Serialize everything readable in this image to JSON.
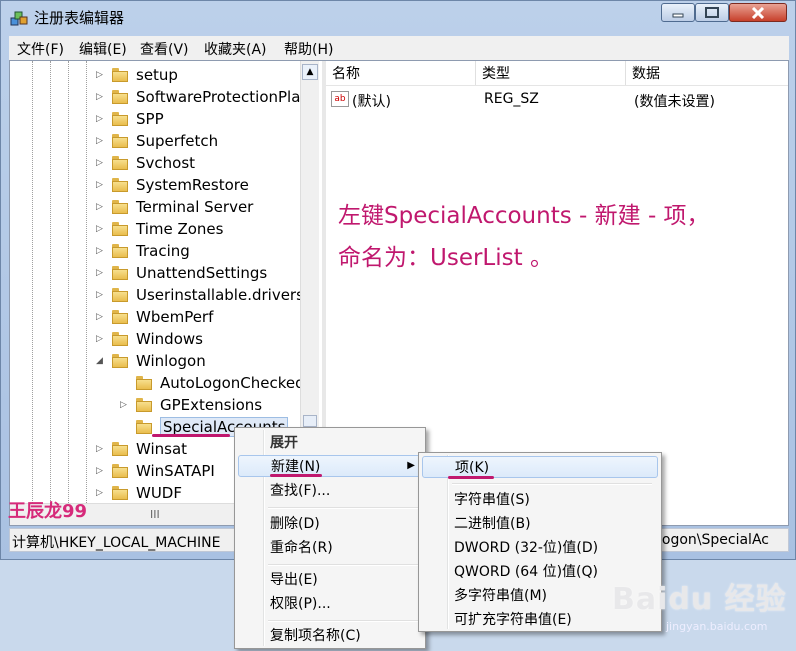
{
  "window": {
    "title": "注册表编辑器"
  },
  "menubar": [
    "文件(F)",
    "编辑(E)",
    "查看(V)",
    "收藏夹(A)",
    "帮助(H)"
  ],
  "tree": {
    "nodes": [
      {
        "label": "setup",
        "level": 0,
        "expander": "collapsed"
      },
      {
        "label": "SoftwareProtectionPla",
        "level": 0,
        "expander": "collapsed"
      },
      {
        "label": "SPP",
        "level": 0,
        "expander": "collapsed"
      },
      {
        "label": "Superfetch",
        "level": 0,
        "expander": "collapsed"
      },
      {
        "label": "Svchost",
        "level": 0,
        "expander": "collapsed"
      },
      {
        "label": "SystemRestore",
        "level": 0,
        "expander": "collapsed"
      },
      {
        "label": "Terminal Server",
        "level": 0,
        "expander": "collapsed"
      },
      {
        "label": "Time Zones",
        "level": 0,
        "expander": "collapsed"
      },
      {
        "label": "Tracing",
        "level": 0,
        "expander": "collapsed"
      },
      {
        "label": "UnattendSettings",
        "level": 0,
        "expander": "collapsed"
      },
      {
        "label": "Userinstallable.drivers",
        "level": 0,
        "expander": "collapsed"
      },
      {
        "label": "WbemPerf",
        "level": 0,
        "expander": "collapsed"
      },
      {
        "label": "Windows",
        "level": 0,
        "expander": "collapsed"
      },
      {
        "label": "Winlogon",
        "level": 0,
        "expander": "expanded"
      },
      {
        "label": "AutoLogonChecked",
        "level": 1,
        "expander": "none"
      },
      {
        "label": "GPExtensions",
        "level": 1,
        "expander": "collapsed"
      },
      {
        "label": "SpecialAccounts",
        "level": 1,
        "expander": "none",
        "selected": true
      },
      {
        "label": "Winsat",
        "level": 0,
        "expander": "collapsed"
      },
      {
        "label": "WinSATAPI",
        "level": 0,
        "expander": "collapsed"
      },
      {
        "label": "WUDF",
        "level": 0,
        "expander": "collapsed"
      }
    ],
    "hscroll_grip": "III"
  },
  "list": {
    "columns": [
      "名称",
      "类型",
      "数据"
    ],
    "rows": [
      {
        "icon": "ab",
        "name": "(默认)",
        "type": "REG_SZ",
        "data": "(数值未设置)"
      }
    ]
  },
  "annotation": {
    "line1": "左键SpecialAccounts - 新建 - 项，",
    "line2": "命名为：UserList 。",
    "color": "#c0186e"
  },
  "watermark_author": "王辰龙99",
  "statusbar": {
    "left": "计算机\\HKEY_LOCAL_MACHINE",
    "right": "logon\\SpecialAc"
  },
  "context_menu": {
    "items": [
      "展开",
      "新建(N)",
      "查找(F)...",
      "删除(D)",
      "重命名(R)",
      "导出(E)",
      "权限(P)...",
      "复制项名称(C)"
    ]
  },
  "submenu": {
    "items": [
      "项(K)",
      "字符串值(S)",
      "二进制值(B)",
      "DWORD (32-位)值(D)",
      "QWORD (64 位)值(Q)",
      "多字符串值(M)",
      "可扩充字符串值(E)"
    ]
  },
  "baidu_watermark": {
    "logo": "Baidu 经验",
    "url": "jingyan.baidu.com"
  }
}
